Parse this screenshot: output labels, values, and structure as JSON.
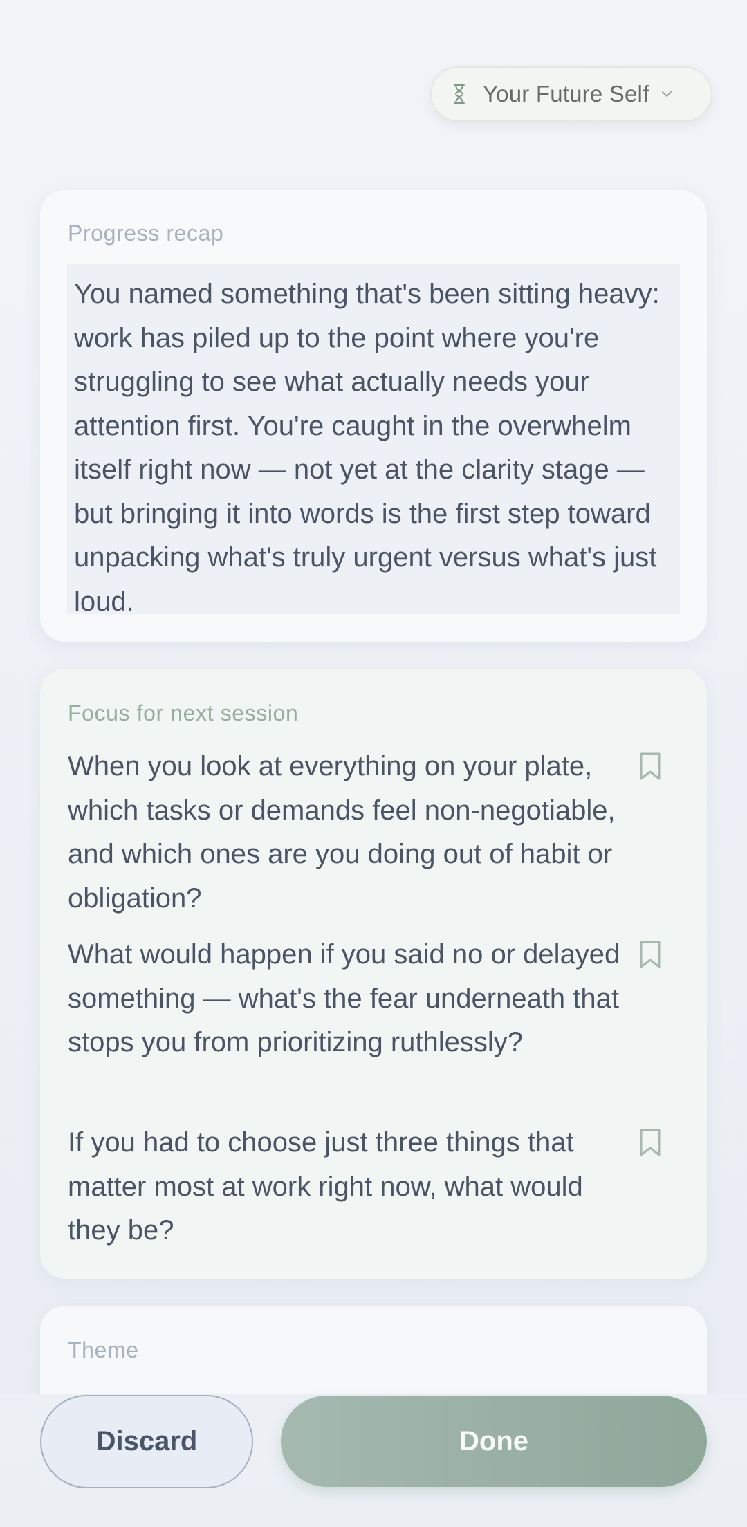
{
  "persona": {
    "label": "Your Future Self",
    "icon": "hourglass-icon"
  },
  "recap": {
    "title": "Progress recap",
    "body": "You named something that's been sitting heavy: work has piled up to the point where you're struggling to see what actually needs your attention first. You're caught in the overwhelm itself right now — not yet at the clarity stage — but bringing it into words is the first step toward unpacking what's truly urgent versus what's just loud."
  },
  "focus": {
    "title": "Focus for next session",
    "questions": [
      {
        "text": "When you look at everything on your plate, which tasks or demands feel non-negotiable, and which ones are you doing out of habit or obligation?"
      },
      {
        "text": "What would happen if you said no or delayed something — what's the fear underneath that stops you from prioritizing ruthlessly?"
      },
      {
        "text": "If you had to choose just three things that matter most at work right now, what would they be?"
      }
    ]
  },
  "theme": {
    "title": "Theme"
  },
  "actions": {
    "discard_label": "Discard",
    "done_label": "Done"
  },
  "colors": {
    "background": "#eef2f6",
    "recap_title": "#a7b2c0",
    "focus_title": "#97ae9c",
    "body_text": "#4b5465",
    "done_button": "#9bb1a5",
    "discard_border": "#a4afc2"
  }
}
